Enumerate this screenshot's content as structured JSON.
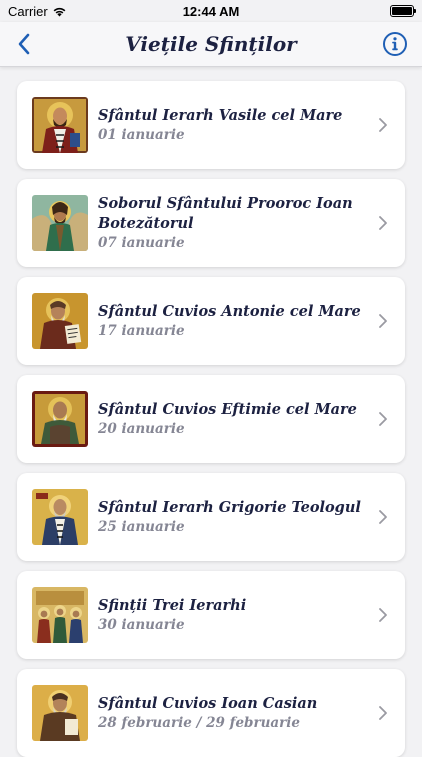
{
  "status": {
    "carrier": "Carrier",
    "time": "12:44 AM"
  },
  "nav": {
    "title": "Viețile Sfinților"
  },
  "saints": [
    {
      "name": "Sfântul Ierarh Vasile cel Mare",
      "date": "01 ianuarie",
      "icon": "saint-basil-icon"
    },
    {
      "name": "Soborul Sfântului Prooroc Ioan Botezătorul",
      "date": "07 ianuarie",
      "icon": "saint-john-baptist-icon"
    },
    {
      "name": "Sfântul Cuvios Antonie cel Mare",
      "date": "17 ianuarie",
      "icon": "saint-anthony-icon"
    },
    {
      "name": "Sfântul Cuvios Eftimie cel Mare",
      "date": "20 ianuarie",
      "icon": "saint-euthymius-icon"
    },
    {
      "name": "Sfântul Ierarh Grigorie Teologul",
      "date": "25 ianuarie",
      "icon": "saint-gregory-icon"
    },
    {
      "name": "Sfinții Trei Ierarhi",
      "date": "30 ianuarie",
      "icon": "three-hierarchs-icon"
    },
    {
      "name": "Sfântul Cuvios Ioan Casian",
      "date": "28 februarie / 29 februarie",
      "icon": "saint-john-cassian-icon"
    }
  ]
}
